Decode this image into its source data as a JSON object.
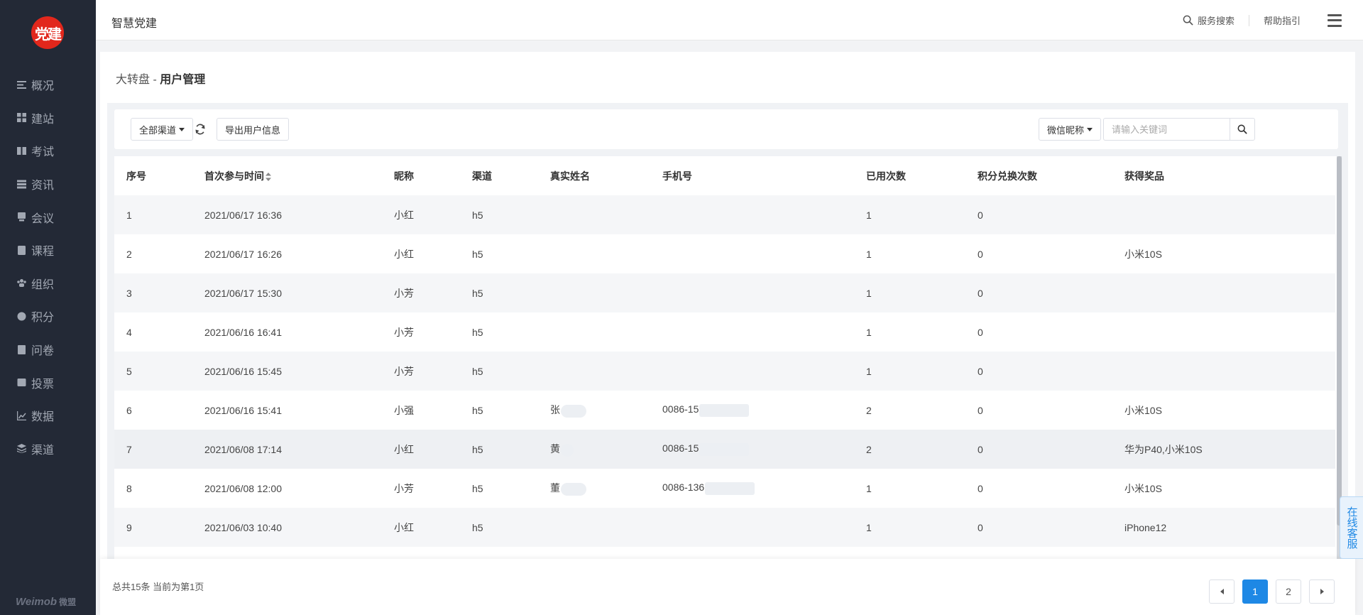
{
  "app": {
    "logo_text": "党建",
    "title": "智慧党建",
    "brand": "Weimob",
    "brand_sub": "微盟"
  },
  "sidebar": {
    "items": [
      {
        "label": "概况",
        "icon": "overview-icon"
      },
      {
        "label": "建站",
        "icon": "grid-icon"
      },
      {
        "label": "考试",
        "icon": "book-icon"
      },
      {
        "label": "资讯",
        "icon": "list-icon"
      },
      {
        "label": "会议",
        "icon": "meeting-icon"
      },
      {
        "label": "课程",
        "icon": "course-icon"
      },
      {
        "label": "组织",
        "icon": "group-icon"
      },
      {
        "label": "积分",
        "icon": "points-icon"
      },
      {
        "label": "问卷",
        "icon": "survey-icon"
      },
      {
        "label": "投票",
        "icon": "vote-icon"
      },
      {
        "label": "数据",
        "icon": "chart-icon"
      },
      {
        "label": "渠道",
        "icon": "layers-icon"
      }
    ]
  },
  "header": {
    "search_label": "服务搜索",
    "help_label": "帮助指引"
  },
  "breadcrumb": {
    "parent": "大转盘",
    "separator": " - ",
    "current": "用户管理"
  },
  "toolbar": {
    "channel_select": "全部渠道",
    "export_label": "导出用户信息",
    "field_select": "微信昵称",
    "search_placeholder": "请输入关键词"
  },
  "table": {
    "columns": [
      "序号",
      "首次参与时间",
      "昵称",
      "渠道",
      "真实姓名",
      "手机号",
      "已用次数",
      "积分兑换次数",
      "获得奖品"
    ],
    "rows": [
      {
        "no": "1",
        "time": "2021/06/17 16:36",
        "nick": "小红",
        "channel": "h5",
        "name": "",
        "phone": "",
        "used": "1",
        "exchange": "0",
        "prize": ""
      },
      {
        "no": "2",
        "time": "2021/06/17 16:26",
        "nick": "小红",
        "channel": "h5",
        "name": "",
        "phone": "",
        "used": "1",
        "exchange": "0",
        "prize": "小米10S"
      },
      {
        "no": "3",
        "time": "2021/06/17 15:30",
        "nick": "小芳",
        "channel": "h5",
        "name": "",
        "phone": "",
        "used": "1",
        "exchange": "0",
        "prize": ""
      },
      {
        "no": "4",
        "time": "2021/06/16 16:41",
        "nick": "小芳",
        "channel": "h5",
        "name": "",
        "phone": "",
        "used": "1",
        "exchange": "0",
        "prize": ""
      },
      {
        "no": "5",
        "time": "2021/06/16 15:45",
        "nick": "小芳",
        "channel": "h5",
        "name": "",
        "phone": "",
        "used": "1",
        "exchange": "0",
        "prize": ""
      },
      {
        "no": "6",
        "time": "2021/06/16 15:41",
        "nick": "小强",
        "channel": "h5",
        "name": "张",
        "phone": "0086-15",
        "used": "2",
        "exchange": "0",
        "prize": "小米10S"
      },
      {
        "no": "7",
        "time": "2021/06/08 17:14",
        "nick": "小红",
        "channel": "h5",
        "name": "黄",
        "phone": "0086-15",
        "used": "2",
        "exchange": "0",
        "prize": "华为P40,小米10S"
      },
      {
        "no": "8",
        "time": "2021/06/08 12:00",
        "nick": "小芳",
        "channel": "h5",
        "name": "董",
        "phone": "0086-136",
        "used": "1",
        "exchange": "0",
        "prize": "小米10S"
      },
      {
        "no": "9",
        "time": "2021/06/03 10:40",
        "nick": "小红",
        "channel": "h5",
        "name": "",
        "phone": "",
        "used": "1",
        "exchange": "0",
        "prize": "iPhone12"
      }
    ]
  },
  "footer": {
    "summary": "总共15条 当前为第1页",
    "pages": [
      "1",
      "2"
    ],
    "current_page": "1"
  },
  "service": {
    "label": "在线客服"
  },
  "colors": {
    "sidebar_bg": "#232936",
    "accent": "#1e88e5",
    "logo_red": "#e2271c"
  }
}
